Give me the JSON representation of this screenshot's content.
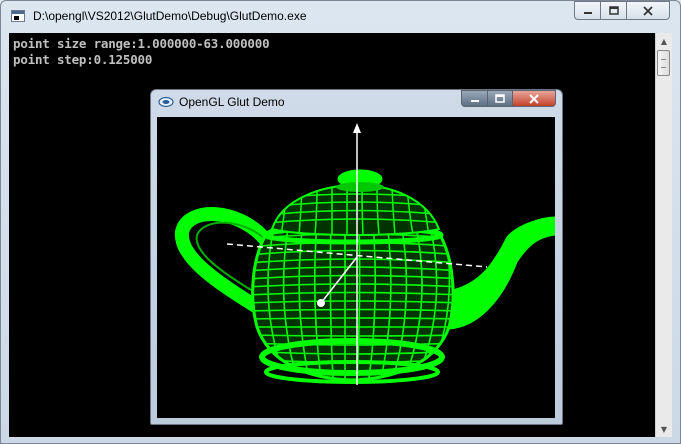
{
  "console": {
    "title": "D:\\opengl\\VS2012\\GlutDemo\\Debug\\GlutDemo.exe",
    "lines": [
      "point size range:1.000000-63.000000",
      "point step:0.125000"
    ]
  },
  "gl_window": {
    "title": "OpenGL Glut Demo"
  },
  "colors": {
    "teapot": "#00ff00",
    "axes": "#ffffff",
    "console_bg": "#000000",
    "console_text": "#c0c0c0"
  },
  "icons": [
    "console-icon",
    "opengl-window-icon",
    "minimize-icon",
    "maximize-icon",
    "close-icon",
    "scroll-up-icon",
    "scroll-down-icon"
  ]
}
